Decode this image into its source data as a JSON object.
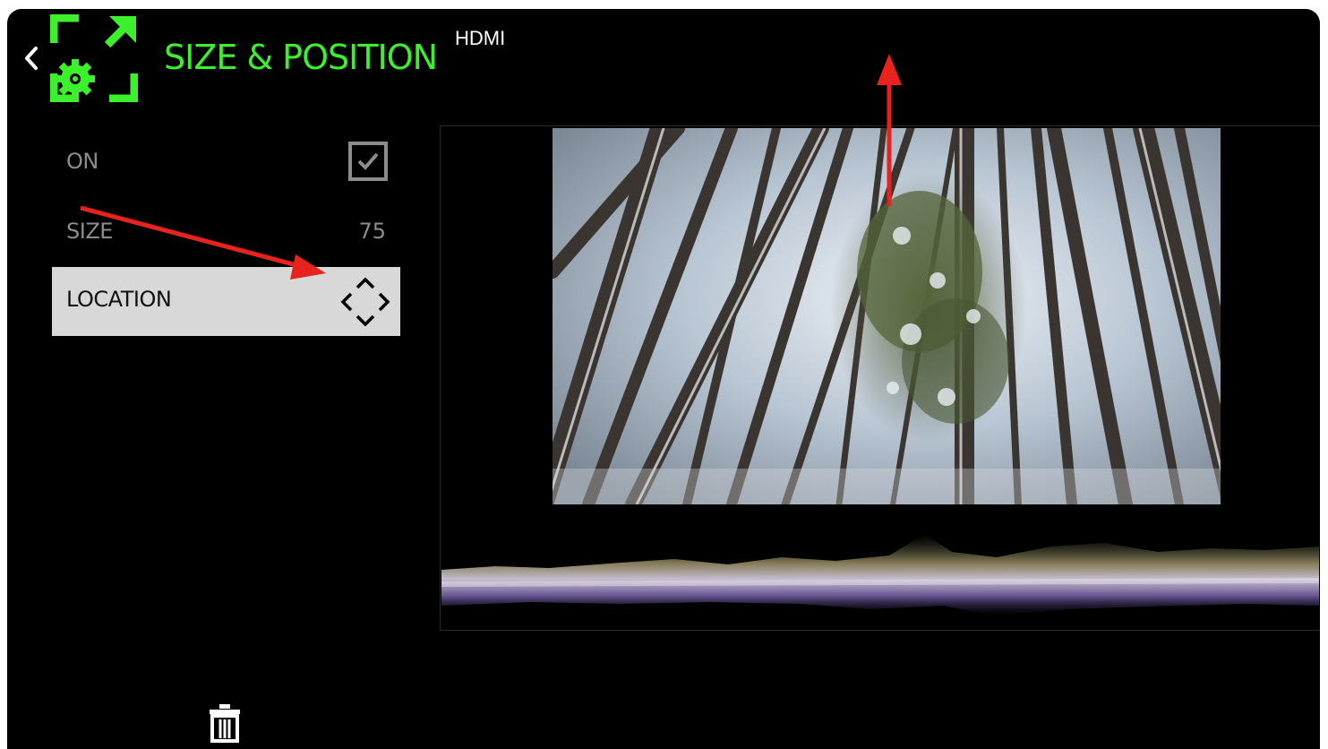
{
  "header": {
    "title": "SIZE & POSITION",
    "source": "HDMI",
    "back_icon": "chevron-left-icon",
    "app_icon": "size-position-gear-icon",
    "accent_color": "#3df02c"
  },
  "menu": {
    "items": [
      {
        "label": "ON",
        "control": "checkbox",
        "checked": true
      },
      {
        "label": "SIZE",
        "value": "75"
      },
      {
        "label": "LOCATION",
        "control": "move-icon",
        "selected": true
      }
    ]
  },
  "preview": {
    "image_description_icon": "snowy-forest-image",
    "scope": "waveform-monitor"
  },
  "footer": {
    "delete_icon": "trash-icon"
  },
  "annotations": {
    "arrow_color": "#e8221c"
  }
}
